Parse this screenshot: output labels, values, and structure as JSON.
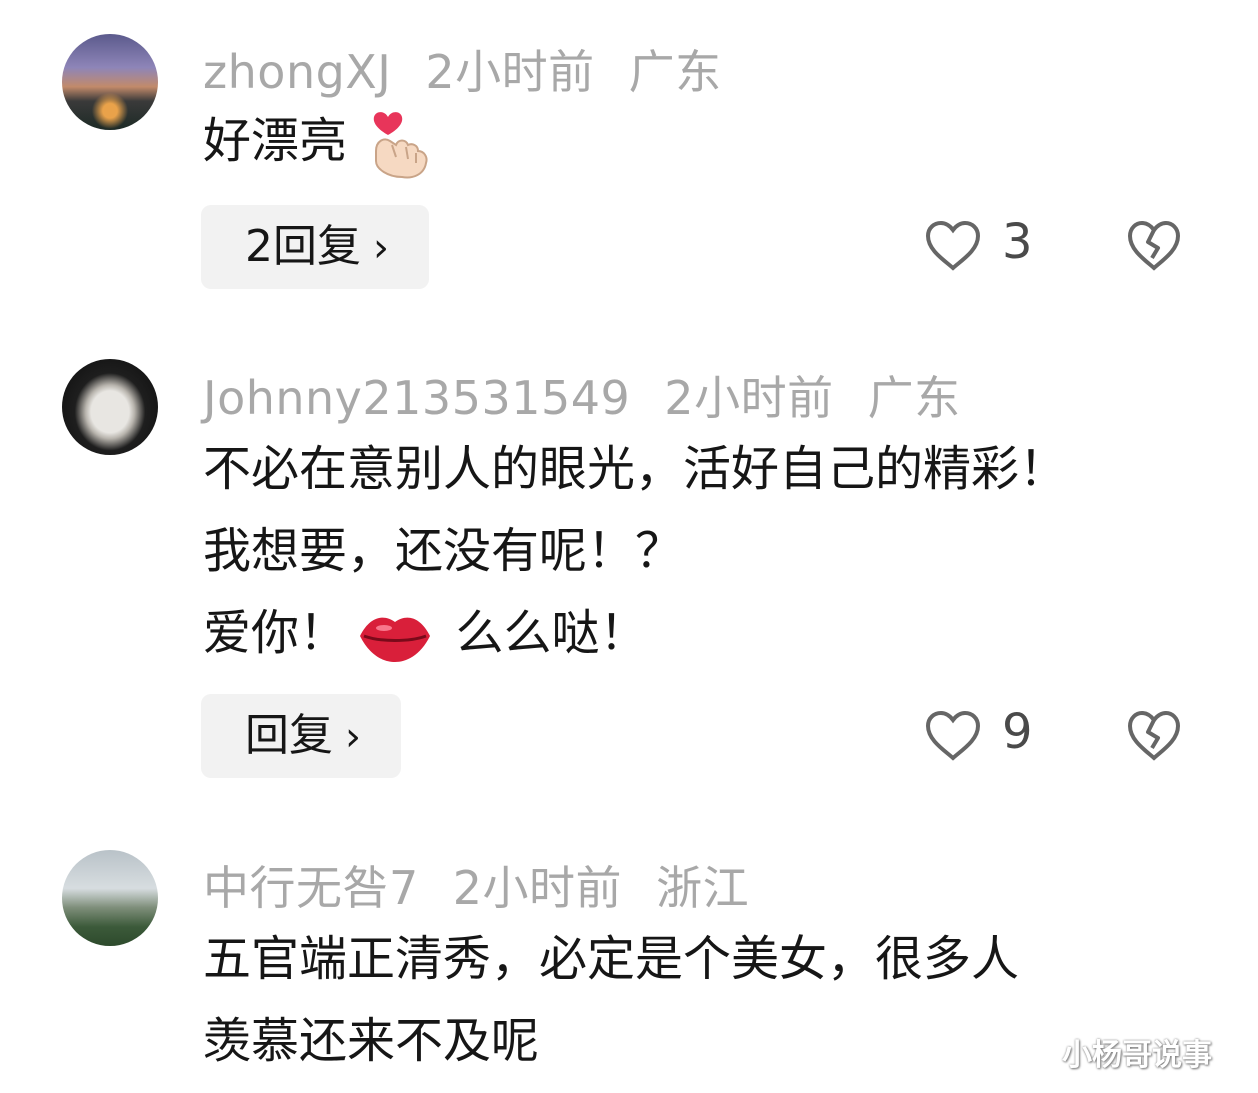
{
  "comments": [
    {
      "avatar": "cityscape-avatar",
      "username": "zhongXJ",
      "time": "2小时前",
      "location": "广东",
      "lines": [
        "好漂亮"
      ],
      "emoji": "finger-heart-emoji",
      "reply_label": "2回复",
      "likes": "3"
    },
    {
      "avatar": "buddha-statue-avatar",
      "username": "Johnny213531549",
      "time": "2小时前",
      "location": "广东",
      "lines": [
        "不必在意别人的眼光，活好自己的精彩！",
        "我想要，还没有呢！？",
        "爱你！",
        "么么哒！"
      ],
      "emoji": "kiss-lips-emoji",
      "reply_label": "回复",
      "likes": "9"
    },
    {
      "avatar": "mountain-landscape-avatar",
      "username": "中行无咎7",
      "time": "2小时前",
      "location": "浙江",
      "lines": [
        "五官端正清秀，必定是个美女，很多人",
        "羡慕还来不及呢"
      ]
    }
  ],
  "chevron": "›",
  "watermark": "小杨哥说事",
  "colors": {
    "meta": "#a8a8a8",
    "text": "#161616",
    "reply_bg": "#f2f2f2"
  }
}
